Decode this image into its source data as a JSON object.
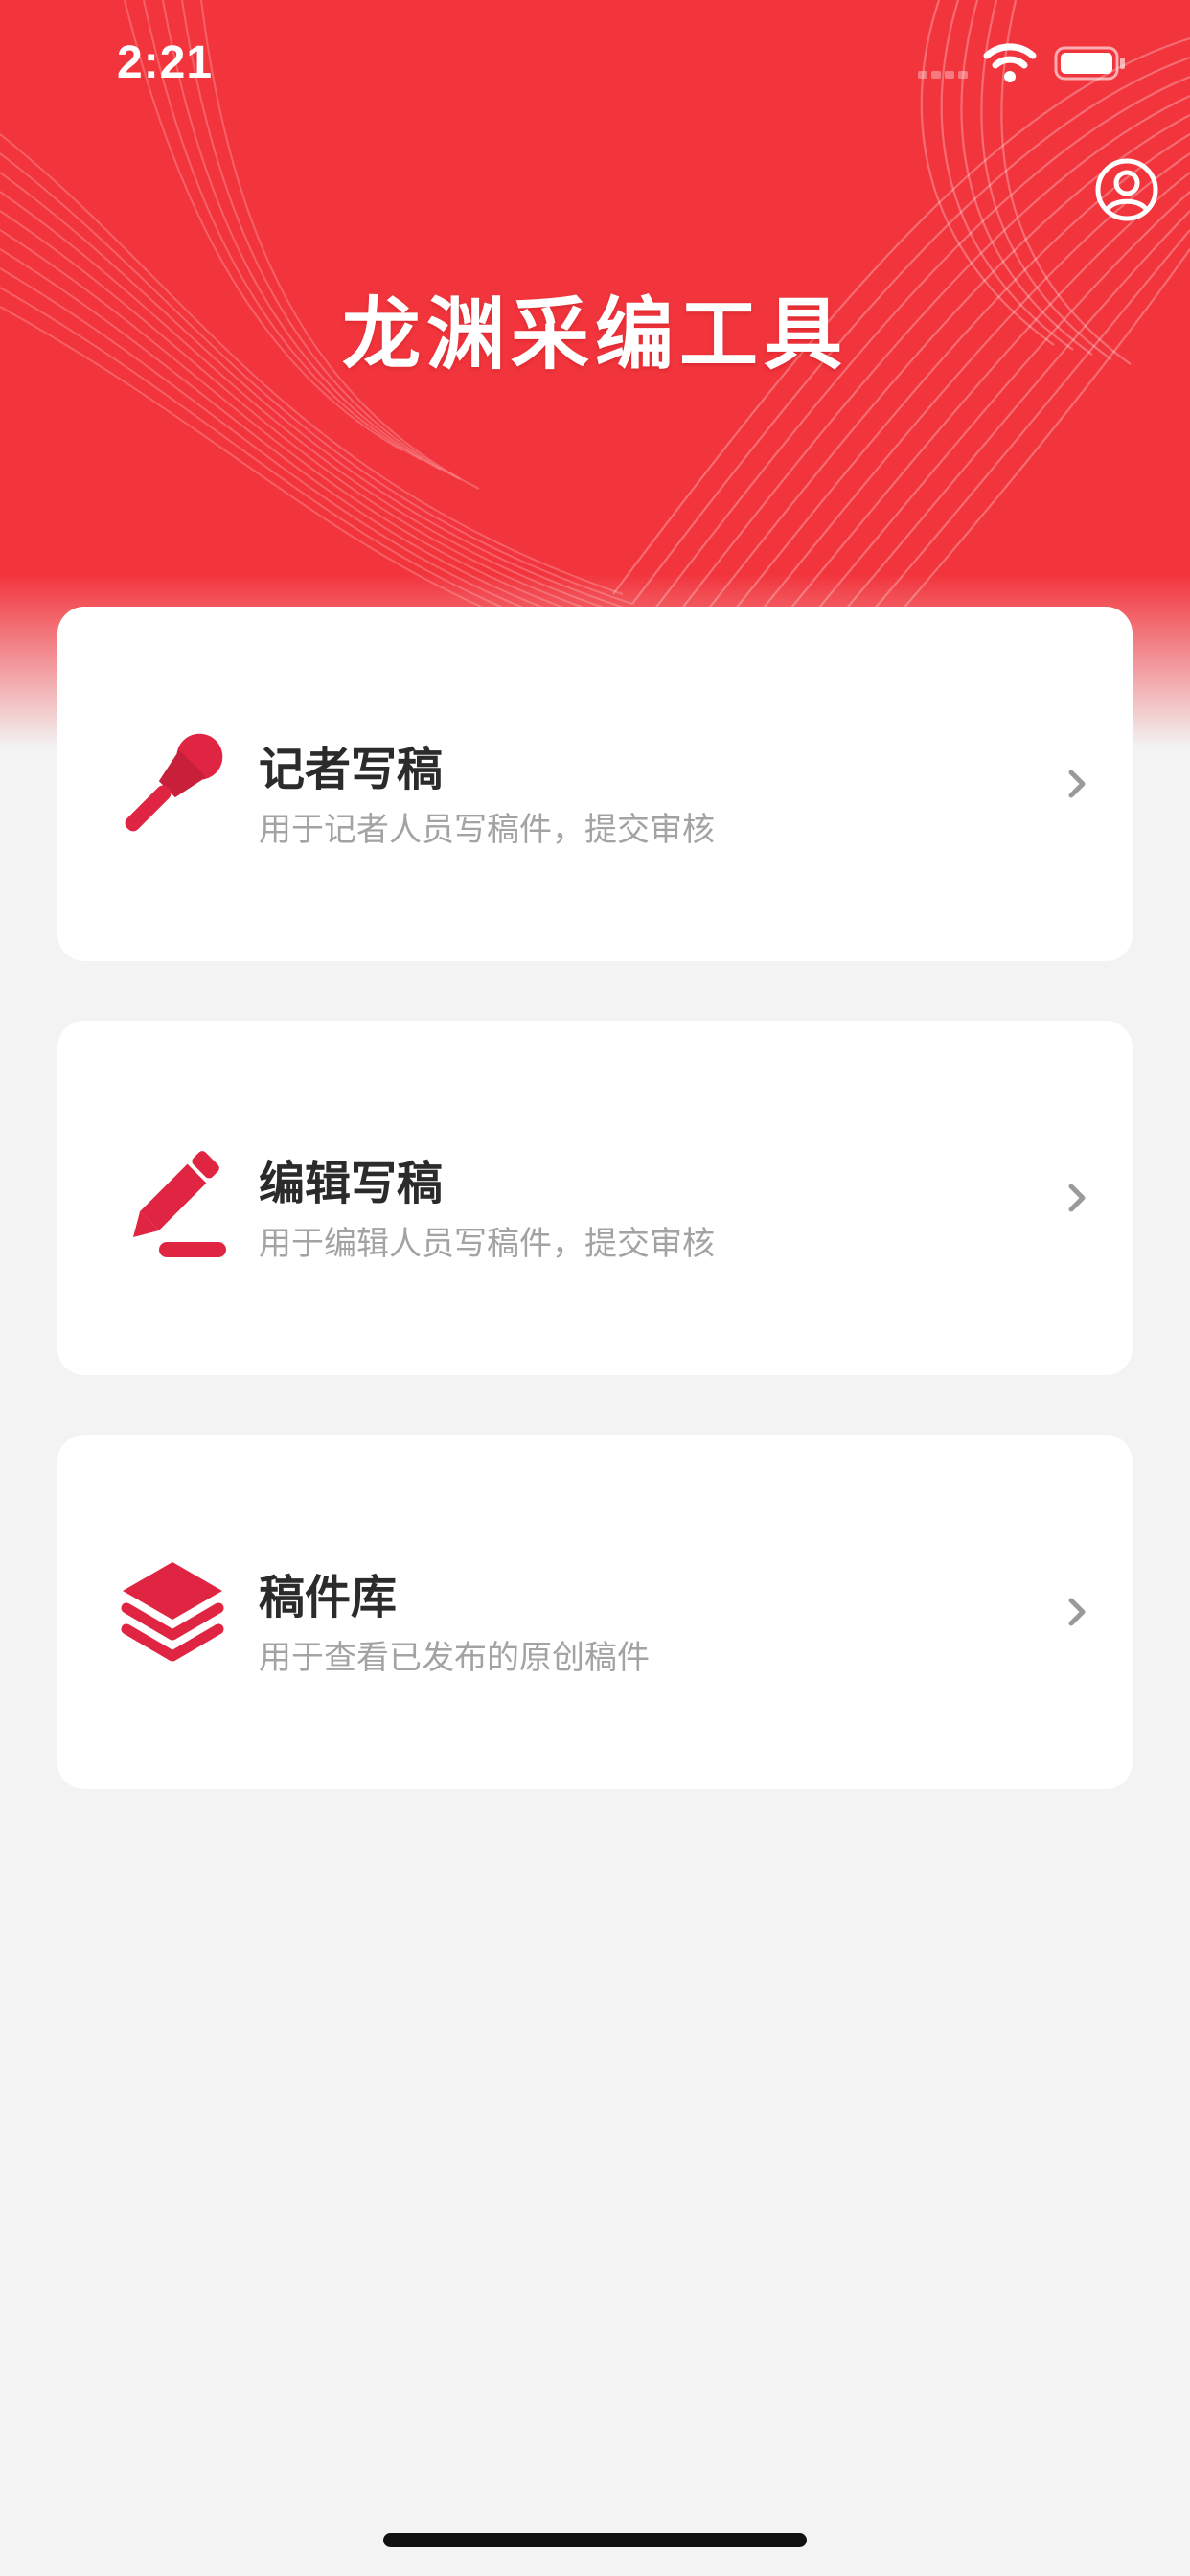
{
  "status_bar": {
    "time": "2:21",
    "icons": [
      "signal-icon",
      "wifi-icon",
      "battery-icon"
    ]
  },
  "header": {
    "title": "龙渊采编工具",
    "profile_icon": "user-circle-icon",
    "background_color": "#f2353d"
  },
  "cards": [
    {
      "icon": "microphone-icon",
      "title": "记者写稿",
      "description": "用于记者人员写稿件，提交审核"
    },
    {
      "icon": "pencil-edit-icon",
      "title": "编辑写稿",
      "description": "用于编辑人员写稿件，提交审核"
    },
    {
      "icon": "layers-icon",
      "title": "稿件库",
      "description": "用于查看已发布的原创稿件"
    }
  ],
  "colors": {
    "accent": "#e02543",
    "page_background": "#f3f3f3",
    "card_background": "#ffffff"
  }
}
